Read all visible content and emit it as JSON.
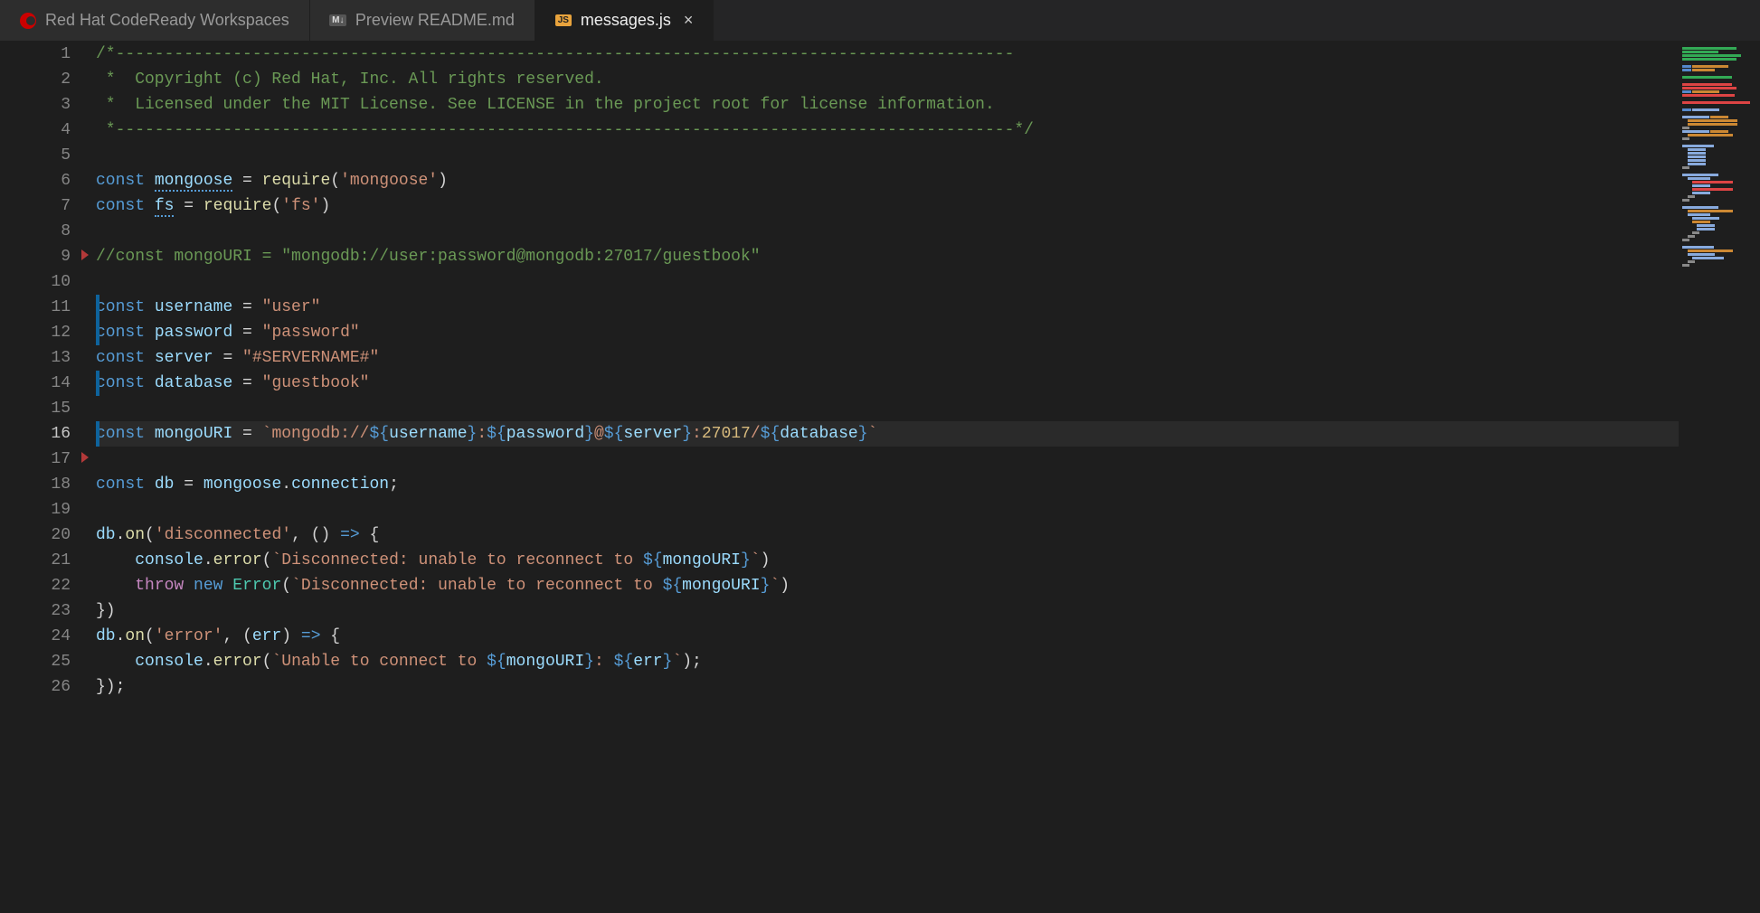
{
  "tabs": [
    {
      "label": "Red Hat CodeReady Workspaces",
      "icon": "redhat",
      "active": false,
      "closable": false
    },
    {
      "label": "Preview README.md",
      "icon": "md",
      "active": false,
      "closable": false
    },
    {
      "label": "messages.js",
      "icon": "js",
      "active": true,
      "closable": true
    }
  ],
  "close_glyph": "×",
  "line_numbers": [
    "1",
    "2",
    "3",
    "4",
    "5",
    "6",
    "7",
    "8",
    "9",
    "10",
    "11",
    "12",
    "13",
    "14",
    "15",
    "16",
    "17",
    "18",
    "19",
    "20",
    "21",
    "22",
    "23",
    "24",
    "25",
    "26"
  ],
  "current_line_index": 15,
  "modified_lines": [
    10,
    11,
    13,
    15
  ],
  "fold_markers_after": [
    8,
    16
  ],
  "code": {
    "l1": "/*--------------------------------------------------------------------------------------------",
    "l2": " *  Copyright (c) Red Hat, Inc. All rights reserved.",
    "l3": " *  Licensed under the MIT License. See LICENSE in the project root for license information.",
    "l4": " *--------------------------------------------------------------------------------------------*/",
    "l6": {
      "kw": "const",
      "sp": " ",
      "var": "mongoose",
      "eq": " = ",
      "fn": "require",
      "op1": "(",
      "str": "'mongoose'",
      "op2": ")"
    },
    "l7": {
      "kw": "const",
      "sp": " ",
      "var": "fs",
      "eq": " = ",
      "fn": "require",
      "op1": "(",
      "str": "'fs'",
      "op2": ")"
    },
    "l9": "//const mongoURI = \"mongodb://user:password@mongodb:27017/guestbook\"",
    "l11": {
      "kw": "const",
      "sp": " ",
      "var": "username",
      "eq": " = ",
      "str": "\"user\""
    },
    "l12": {
      "kw": "const",
      "sp": " ",
      "var": "password",
      "eq": " = ",
      "str": "\"password\""
    },
    "l13": {
      "kw": "const",
      "sp": " ",
      "var": "server",
      "eq": " = ",
      "str": "\"#SERVERNAME#\""
    },
    "l14": {
      "kw": "const",
      "sp": " ",
      "var": "database",
      "eq": " = ",
      "str": "\"guestbook\""
    },
    "l16": {
      "kw": "const",
      "sp": " ",
      "var": "mongoURI",
      "eq": " = ",
      "s1": "`mongodb://",
      "d1": "${",
      "v1": "username",
      "d1b": "}",
      "s2": ":",
      "d2": "${",
      "v2": "password",
      "d2b": "}",
      "s3": "@",
      "d3": "${",
      "v3": "server",
      "d3b": "}",
      "s4": ":",
      "port": "27017",
      "s5": "/",
      "d4": "${",
      "v4": "database",
      "d4b": "}",
      "s6": "`"
    },
    "l18": {
      "kw": "const",
      "sp": " ",
      "var": "db",
      "eq": " = ",
      "obj": "mongoose",
      "dot": ".",
      "prop": "connection",
      "semi": ";"
    },
    "l20": {
      "obj": "db",
      "dot": ".",
      "fn": "on",
      "op1": "(",
      "str": "'disconnected'",
      "comma": ", () ",
      "arrow": "=>",
      "sp": " {",
      "open": ""
    },
    "l21": {
      "pad": "    ",
      "obj": "console",
      "dot": ".",
      "fn": "error",
      "op1": "(",
      "s1": "`Disconnected: unable to reconnect to ",
      "d1": "${",
      "v1": "mongoURI",
      "d1b": "}",
      "s2": "`",
      "op2": ")"
    },
    "l22": {
      "pad": "    ",
      "kw": "throw",
      "sp": " ",
      "new": "new",
      "sp2": " ",
      "cls": "Error",
      "op1": "(",
      "s1": "`Disconnected: unable to reconnect to ",
      "d1": "${",
      "v1": "mongoURI",
      "d1b": "}",
      "s2": "`",
      "op2": ")"
    },
    "l23": "})",
    "l24": {
      "obj": "db",
      "dot": ".",
      "fn": "on",
      "op1": "(",
      "str": "'error'",
      "comma": ", (",
      "arg": "err",
      "close": ") ",
      "arrow": "=>",
      "sp": " {"
    },
    "l25": {
      "pad": "    ",
      "obj": "console",
      "dot": ".",
      "fn": "error",
      "op1": "(",
      "s1": "`Unable to connect to ",
      "d1": "${",
      "v1": "mongoURI",
      "d1b": "}",
      "s2": ": ",
      "d2": "${",
      "v2": "err",
      "d2b": "}",
      "s3": "`",
      "op2": ");"
    },
    "l26": "});"
  }
}
